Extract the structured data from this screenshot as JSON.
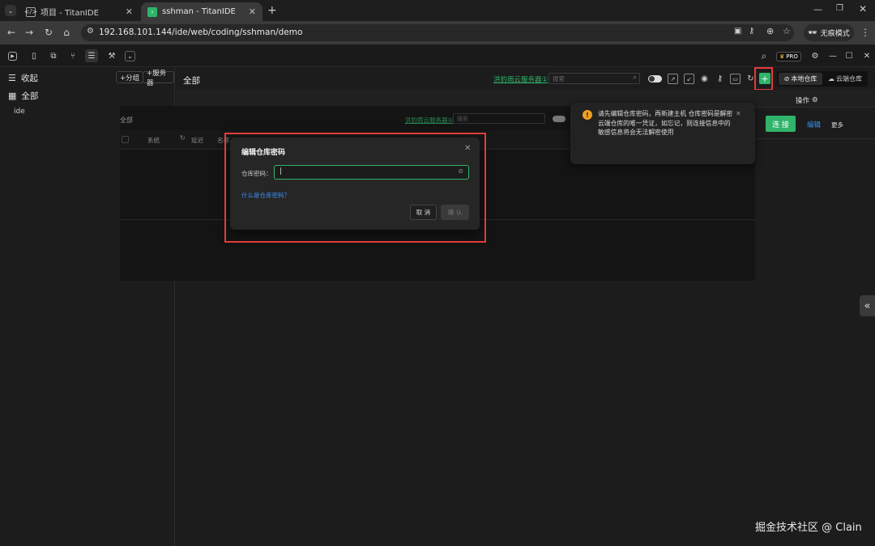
{
  "browser": {
    "tabs": [
      {
        "title": "项目 - TitanIDE",
        "active": false
      },
      {
        "title": "sshman - TitanIDE",
        "active": true
      }
    ],
    "url": "192.168.101.144/ide/web/coding/sshman/demo",
    "incognito_label": "无痕模式"
  },
  "app": {
    "pro_badge": "PRO"
  },
  "sidebar": {
    "add_group": "+分组",
    "add_server": "+服务器",
    "collapse": "收起",
    "all": "全部",
    "items": [
      "ide"
    ]
  },
  "main": {
    "title": "全部",
    "cloud_link": "洪豹雨云服务器①",
    "search_placeholder": "搜索",
    "local_repo": "本地仓库",
    "cloud_repo": "云端仓库",
    "actions_header": "操作",
    "connect": "连 接",
    "edit": "编辑",
    "more": "更多"
  },
  "ghost": {
    "title": "全部",
    "cloud_link": "洪豹雨云服务器①",
    "search_placeholder": "搜索",
    "col_system": "系统",
    "col_latency": "延迟",
    "col_name": "名称"
  },
  "dialog": {
    "title": "编辑仓库密码",
    "label": "仓库密码：",
    "value": "|",
    "help_link": "什么是仓库密码？",
    "cancel": "取 消",
    "confirm": "确 认"
  },
  "notice": {
    "text": "请先编辑仓库密码，再新建主机 仓库密码是解密云端仓库的唯一凭证，如忘记，则连接信息中的敏感信息将会无法解密使用"
  },
  "watermark": "掘金技术社区 @ Clain",
  "colors": {
    "accent_green": "#2fb46a",
    "link_blue": "#3b8ff0",
    "highlight_red": "#e23b3b",
    "warning_orange": "#f0a020"
  }
}
